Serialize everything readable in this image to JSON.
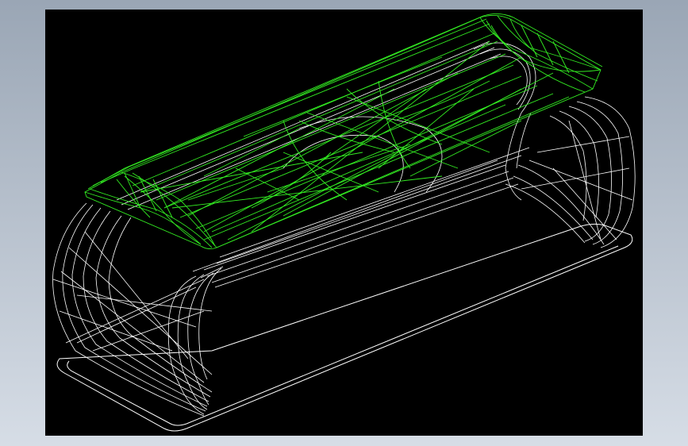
{
  "window": {
    "background_top": "#9aa6b5",
    "background_bottom": "#d6dde6"
  },
  "viewport": {
    "background": "#000000",
    "description_icon": "cad-wireframe-viewport"
  },
  "model": {
    "seat_color": "#33ee22",
    "frame_color": "#ffffff",
    "base_color": "#ffffff"
  }
}
